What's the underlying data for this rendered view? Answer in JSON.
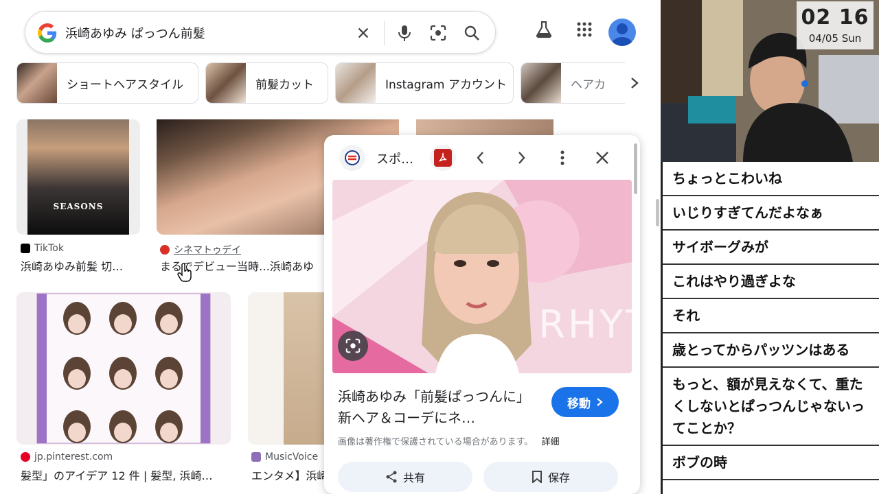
{
  "search": {
    "query": "浜崎あゆみ ぱっつん前髪"
  },
  "chips": [
    {
      "label": "ショートヘアスタイル"
    },
    {
      "label": "前髪カット"
    },
    {
      "label": "Instagram アカウント"
    },
    {
      "label": "ヘアカ"
    }
  ],
  "results": [
    {
      "source": "TikTok",
      "caption": "浜崎あゆみ前髪 切…",
      "image_text": "SEASONS"
    },
    {
      "source": "シネマトゥデイ",
      "caption": "まるでデビュー当時…浜崎あゆ"
    },
    {
      "source": "jp.pinterest.com",
      "caption": "髪型」のアイデア 12 件 | 髪型, 浜崎…"
    },
    {
      "source": "MusicVoice",
      "caption": "エンタメ】浜崎"
    }
  ],
  "preview": {
    "site_name": "スポ…",
    "title": "浜崎あゆみ「前髪ぱっつんに」 新ヘア＆コーデにネ…",
    "go_label": "移動",
    "copyright": "画像は著作権で保護されている場合があります。",
    "details_label": "詳細",
    "share_label": "共有",
    "save_label": "保存",
    "image_text": "RHYTHM"
  },
  "overlay": {
    "time": "02 16",
    "date": "04/05 Sun"
  },
  "chat": [
    "ちょっとこわいね",
    "いじりすぎてんだよなぁ",
    "サイボーグみが",
    "これはやり過ぎよな",
    "それ",
    "歳とってからパッツンはある",
    "もっと、額が見えなくて、重たくしないとぱっつんじゃないってことか？",
    "ボブの時"
  ],
  "colors": {
    "accent": "#1a73e8",
    "pdf_red": "#c5221f"
  }
}
